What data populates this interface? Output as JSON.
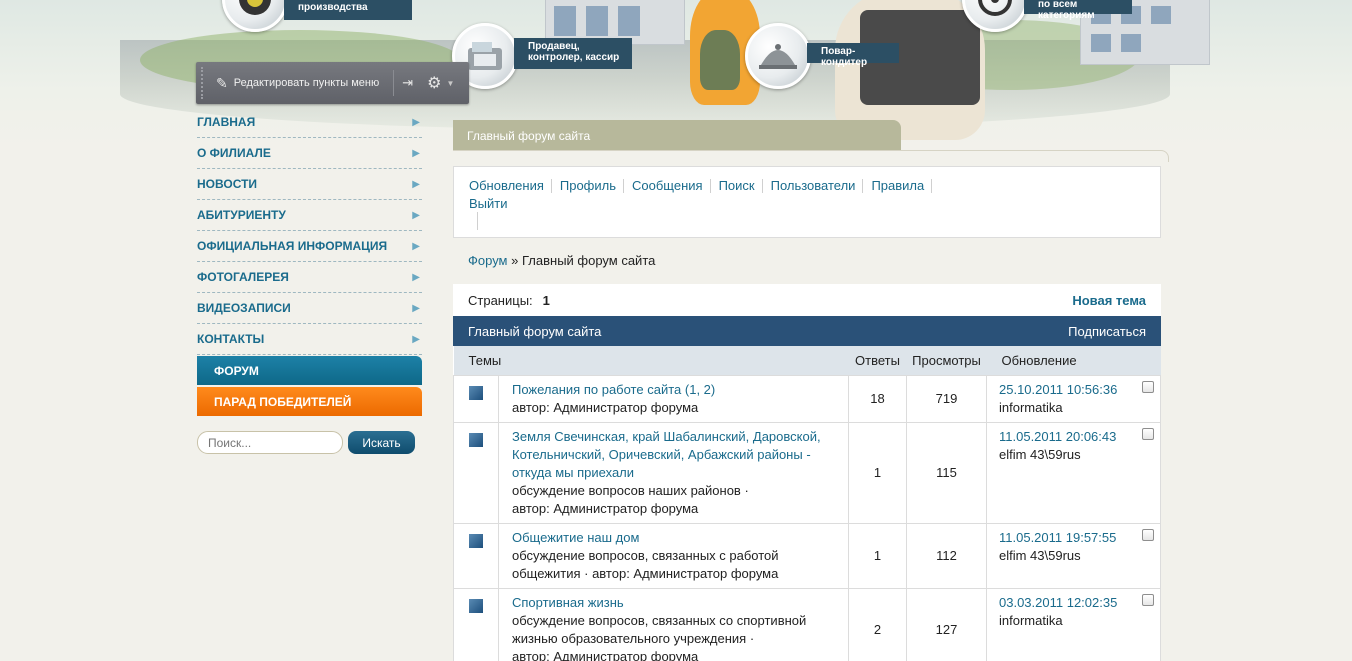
{
  "banner": {
    "categories": [
      {
        "label": "производства"
      },
      {
        "label": "Продавец, контролер, кассир"
      },
      {
        "label": "Повар-кондитер"
      },
      {
        "label": "по всем категориям"
      }
    ]
  },
  "edit_bar": {
    "label": "Редактировать пункты меню"
  },
  "left_nav": {
    "items": [
      {
        "label": "ГЛАВНАЯ"
      },
      {
        "label": "О ФИЛИАЛЕ"
      },
      {
        "label": "НОВОСТИ"
      },
      {
        "label": "АБИТУРИЕНТУ"
      },
      {
        "label": "ОФИЦИАЛЬНАЯ ИНФОРМАЦИЯ"
      },
      {
        "label": "ФОТОГАЛЕРЕЯ"
      },
      {
        "label": "ВИДЕОЗАПИСИ"
      },
      {
        "label": "КОНТАКТЫ"
      }
    ],
    "active": "ФОРУМ",
    "highlight": "ПАРАД ПОБЕДИТЕЛЕЙ"
  },
  "search": {
    "placeholder": "Поиск...",
    "button": "Искать"
  },
  "forum": {
    "tab_title": "Главный форум сайта",
    "menu": [
      "Обновления",
      "Профиль",
      "Сообщения",
      "Поиск",
      "Пользователи",
      "Правила"
    ],
    "menu_logout": "Выйти",
    "breadcrumb": {
      "root": "Форум",
      "separator": "»",
      "current": "Главный форум сайта"
    },
    "pages_label": "Страницы:",
    "pages_value": "1",
    "new_topic": "Новая тема",
    "section_title": "Главный форум сайта",
    "subscribe": "Подписаться",
    "columns": {
      "topics": "Темы",
      "replies": "Ответы",
      "views": "Просмотры",
      "updated": "Обновление"
    },
    "topics": [
      {
        "title": "Пожелания по работе сайта",
        "pages_open": " (",
        "page1": "1",
        "page_sep": ", ",
        "page2": "2",
        "pages_close": ")",
        "lines": [
          "автор: Администратор форума"
        ],
        "replies": "18",
        "views": "719",
        "date": "25.10.2011 10:56:36",
        "user": "informatika"
      },
      {
        "title": "Земля Свечинская, край Шабалинский, Даровской, Котельничский, Оричевский, Арбажский районы - откуда мы приехали",
        "lines": [
          "обсуждение вопросов наших районов ·",
          "автор: Администратор форума"
        ],
        "replies": "1",
        "views": "115",
        "date": "11.05.2011 20:06:43",
        "user": "elfim 43\\59rus"
      },
      {
        "title": "Общежитие наш дом",
        "lines": [
          "обсуждение вопросов, связанных с работой",
          "общежития · автор: Администратор форума"
        ],
        "replies": "1",
        "views": "112",
        "date": "11.05.2011 19:57:55",
        "user": "elfim 43\\59rus"
      },
      {
        "title": "Спортивная жизнь",
        "lines": [
          "обсуждение вопросов, связанных со спортивной",
          "жизнью образовательного учреждения ·",
          "автор: Администратор форума"
        ],
        "replies": "2",
        "views": "127",
        "date": "03.03.2011 12:02:35",
        "user": "informatika"
      }
    ]
  }
}
